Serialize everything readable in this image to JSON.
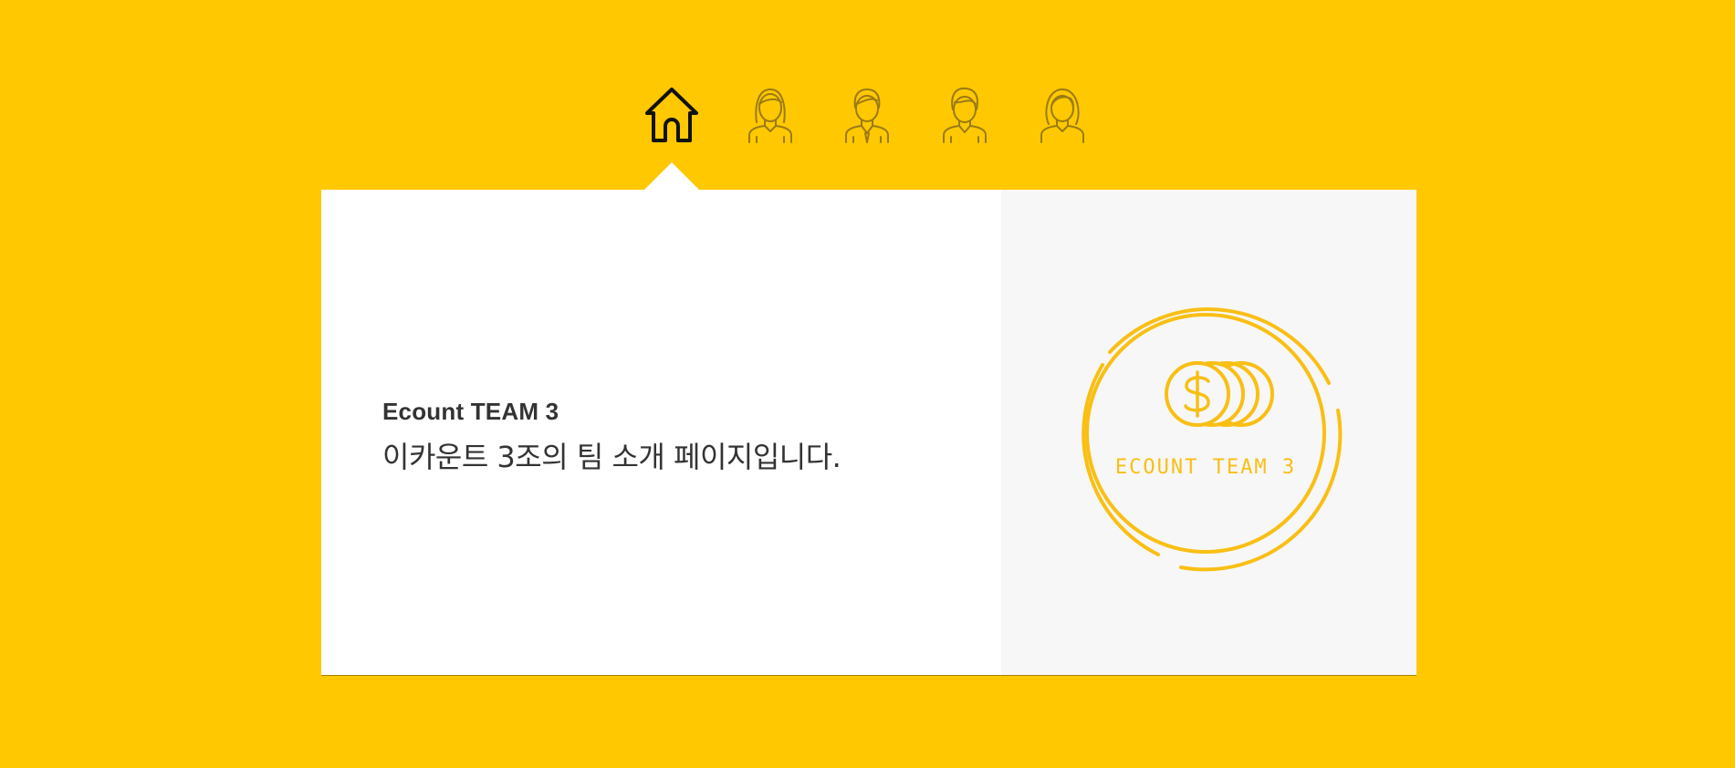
{
  "nav": {
    "items": [
      {
        "icon": "home-icon",
        "active": true
      },
      {
        "icon": "female-member-icon",
        "active": false
      },
      {
        "icon": "male-member-icon",
        "active": false
      },
      {
        "icon": "male-member-icon",
        "active": false
      },
      {
        "icon": "female-member-icon",
        "active": false
      }
    ]
  },
  "card": {
    "title": "Ecount TEAM 3",
    "description": "이카운트 3조의 팀 소개 페이지입니다.",
    "logo_text": "ECOUNT TEAM 3"
  },
  "colors": {
    "background": "#FFC800",
    "card": "#FFFFFF",
    "panel": "#F7F7F7",
    "logo": "#F9BF14",
    "text": "#333333",
    "active_icon": "#111111",
    "inactive_icon": "#9A7A14"
  }
}
